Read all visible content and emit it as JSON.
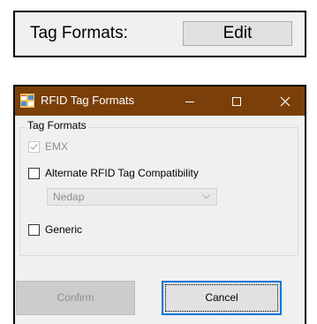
{
  "top": {
    "label": "Tag Formats:",
    "edit_button": "Edit"
  },
  "dialog": {
    "title": "RFID Tag Formats",
    "titlebar_color": "#7b3f09",
    "controls": {
      "minimize": "minimize-icon",
      "maximize": "maximize-icon",
      "close": "close-icon"
    },
    "group": {
      "title": "Tag Formats",
      "options": {
        "emx": {
          "label": "EMX",
          "checked": true,
          "enabled": false
        },
        "alternate": {
          "label": "Alternate RFID Tag Compatibility",
          "checked": false,
          "enabled": true
        },
        "generic": {
          "label": "Generic",
          "checked": false,
          "enabled": true
        }
      },
      "compat_select": {
        "value": "Nedap",
        "enabled": false
      }
    },
    "buttons": {
      "confirm": "Confirm",
      "cancel": "Cancel"
    }
  }
}
